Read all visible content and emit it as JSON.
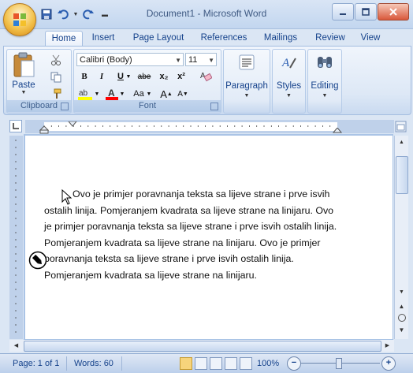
{
  "window": {
    "title": "Document1 - Microsoft Word"
  },
  "quick_access": {
    "items": [
      "save-icon",
      "undo-icon",
      "redo-icon",
      "customize-icon"
    ]
  },
  "tabs": [
    {
      "label": "Home",
      "active": true
    },
    {
      "label": "Insert"
    },
    {
      "label": "Page Layout"
    },
    {
      "label": "References"
    },
    {
      "label": "Mailings"
    },
    {
      "label": "Review"
    },
    {
      "label": "View"
    }
  ],
  "ribbon": {
    "clipboard": {
      "group_label": "Clipboard",
      "paste_label": "Paste"
    },
    "font": {
      "group_label": "Font",
      "font_name": "Calibri (Body)",
      "font_size": "11",
      "bold": "B",
      "italic": "I",
      "underline": "U",
      "strikethrough": "abe",
      "subscript": "x₂",
      "superscript": "x²",
      "change_case": "Aa",
      "grow": "A",
      "shrink": "A"
    },
    "paragraph": {
      "group_label": "Paragraph"
    },
    "styles": {
      "group_label": "Styles"
    },
    "editing": {
      "group_label": "Editing"
    }
  },
  "document": {
    "text": "Ovo je primjer poravnanja teksta sa lijeve strane i prve isvih ostalih linija. Pomjeranjem kvadrata sa lijeve strane na linijaru. Ovo je primjer poravnanja teksta sa lijeve strane i prve isvih ostalih linija. Pomjeranjem kvadrata sa lijeve strane na linijaru. Ovo je primjer poravnanja teksta sa lijeve strane i prve isvih ostalih linija. Pomjeranjem kvadrata sa lijeve strane na linijaru."
  },
  "status_bar": {
    "page": "Page: 1 of 1",
    "words": "Words: 60",
    "zoom": "100%"
  },
  "colors": {
    "highlight": "#ffff00",
    "font_color": "#ff0000",
    "ribbon_text": "#15428b"
  }
}
